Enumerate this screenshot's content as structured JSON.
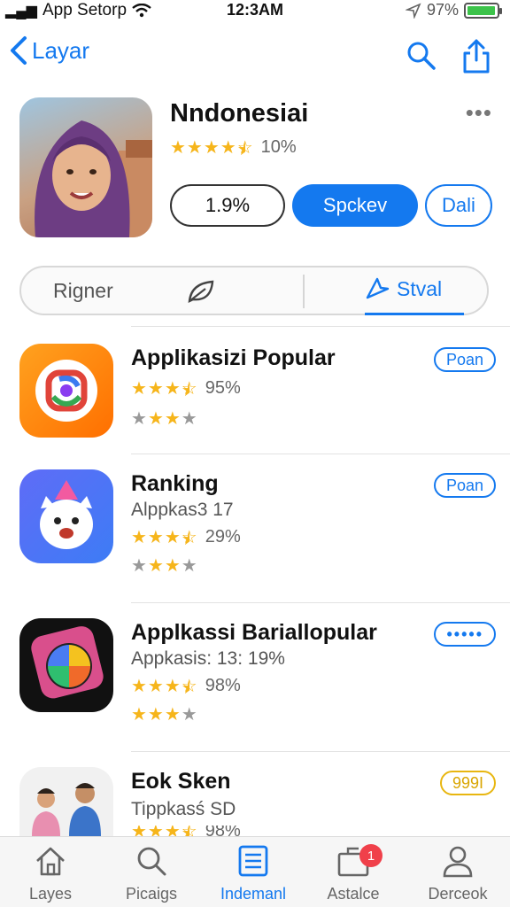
{
  "status_bar": {
    "carrier": "App Setorp",
    "time": "12:3AM",
    "battery_text": "97%",
    "battery_level": 0.97,
    "battery_color": "#3cc34a"
  },
  "nav": {
    "back_label": "Layar",
    "icons": [
      "search-icon",
      "share-icon"
    ]
  },
  "app": {
    "title": "Nndonesiai",
    "stars": 4.5,
    "rating_text": "10%",
    "buttons": {
      "secondary": "1.9%",
      "primary": "Spckev",
      "tertiary": "Dali"
    }
  },
  "segment": {
    "left_label": "Rigner",
    "right_label": "Stval"
  },
  "list": [
    {
      "title": "Applikasizi Popular",
      "subtitle": "",
      "stars": 3.5,
      "rating_text": "95%",
      "pill": "Poan"
    },
    {
      "title": "Ranking",
      "subtitle": "Alppkas3 17",
      "stars": 3.5,
      "rating_text": "29%",
      "pill": "Poan"
    },
    {
      "title": "Applkassi Bariallopular",
      "subtitle": "Appkasis: 13: 19%",
      "stars": 3.5,
      "rating_text": "98%",
      "pill": "•••••"
    },
    {
      "title": "Eok Sken",
      "subtitle": "Tippkasś SD",
      "stars": 3.5,
      "rating_text": "98%",
      "pill": "999I"
    }
  ],
  "tabbar": {
    "tabs": [
      {
        "label": "Layes",
        "icon": "home-icon"
      },
      {
        "label": "Picaigs",
        "icon": "search-icon"
      },
      {
        "label": "Indemanl",
        "icon": "document-icon"
      },
      {
        "label": "Astalce",
        "icon": "tray-icon",
        "badge": "1"
      },
      {
        "label": "Derceok",
        "icon": "person-icon"
      }
    ],
    "active_index": 2
  },
  "colors": {
    "accent": "#1479ef",
    "star": "#f6b51b",
    "badge": "#f0404a",
    "gold_pill": "#d9a500"
  }
}
